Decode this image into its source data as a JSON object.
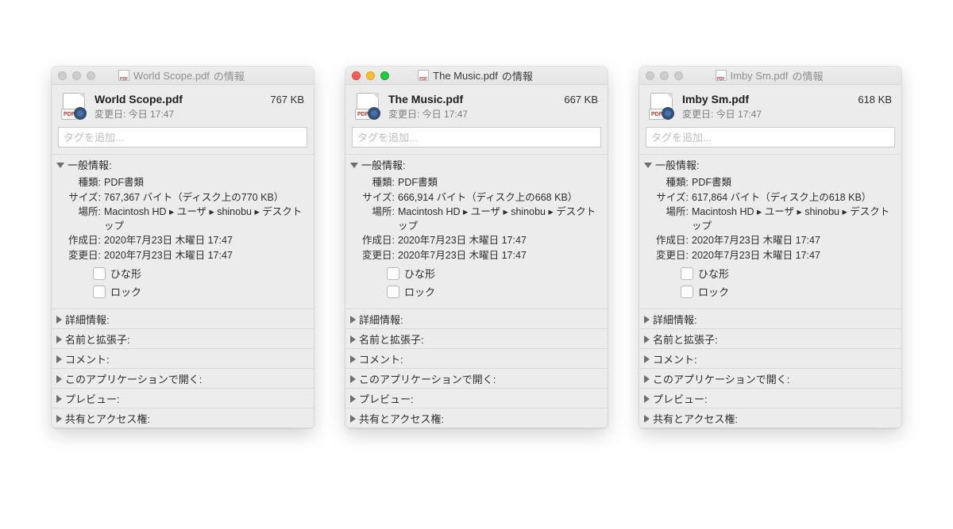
{
  "tags_placeholder": "タグを追加...",
  "labels": {
    "modified": "変更日: ",
    "general": "一般情報:",
    "kind": "種類:",
    "size": "サイズ:",
    "where": "場所:",
    "created": "作成日:",
    "modified_full": "変更日:",
    "stationery": "ひな形",
    "locked": "ロック",
    "more_info": "詳細情報:",
    "name_ext": "名前と拡張子:",
    "comments": "コメント:",
    "open_with": "このアプリケーションで開く:",
    "preview": "プレビュー:",
    "sharing": "共有とアクセス権:",
    "title_suffix": "の情報"
  },
  "windows": [
    {
      "focused": false,
      "filename": "World Scope.pdf",
      "filesize": "767 KB",
      "modified_short": "今日 17:47",
      "general": {
        "kind": "PDF書類",
        "size": "767,367 バイト（ディスク上の770 KB）",
        "where": "Macintosh HD ▸ ユーザ ▸ shinobu ▸ デスクトップ",
        "created": "2020年7月23日 木曜日 17:47",
        "modified": "2020年7月23日 木曜日 17:47"
      }
    },
    {
      "focused": true,
      "filename": "The Music.pdf",
      "filesize": "667 KB",
      "modified_short": "今日 17:47",
      "general": {
        "kind": "PDF書類",
        "size": "666,914 バイト（ディスク上の668 KB）",
        "where": "Macintosh HD ▸ ユーザ ▸ shinobu ▸ デスクトップ",
        "created": "2020年7月23日 木曜日 17:47",
        "modified": "2020年7月23日 木曜日 17:47"
      }
    },
    {
      "focused": false,
      "filename": "Imby Sm.pdf",
      "filesize": "618 KB",
      "modified_short": "今日 17:47",
      "general": {
        "kind": "PDF書類",
        "size": "617,864 バイト（ディスク上の618 KB）",
        "where": "Macintosh HD ▸ ユーザ ▸ shinobu ▸ デスクトップ",
        "created": "2020年7月23日 木曜日 17:47",
        "modified": "2020年7月23日 木曜日 17:47"
      }
    }
  ]
}
